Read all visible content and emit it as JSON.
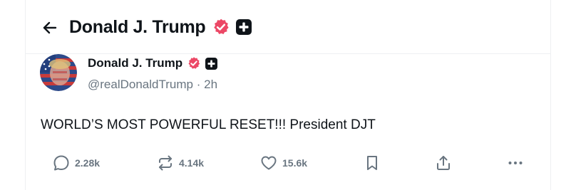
{
  "header": {
    "back_icon": "arrow-left-icon",
    "title": "Donald J. Trump",
    "verified_icon": "verified-badge-icon",
    "plus_icon": "plus-badge-icon",
    "verified_color": "#ec4866"
  },
  "post": {
    "author": {
      "display_name": "Donald J. Trump",
      "handle": "@realDonaldTrump",
      "separator": "·",
      "time": "2h",
      "avatar_icon": "avatar-image"
    },
    "text": "WORLD’S MOST POWERFUL RESET!!! President DJT",
    "actions": {
      "reply": {
        "icon": "reply-icon",
        "count": "2.28k"
      },
      "retruth": {
        "icon": "retruth-icon",
        "count": "4.14k"
      },
      "like": {
        "icon": "heart-icon",
        "count": "15.6k"
      },
      "bookmark": {
        "icon": "bookmark-icon"
      },
      "share": {
        "icon": "share-icon"
      },
      "more": {
        "icon": "more-horizontal-icon"
      }
    }
  },
  "colors": {
    "text": "#0f1419",
    "muted": "#697580",
    "divider": "#eef0f2",
    "verified": "#ec4866",
    "badge_bg": "#0f1419"
  }
}
